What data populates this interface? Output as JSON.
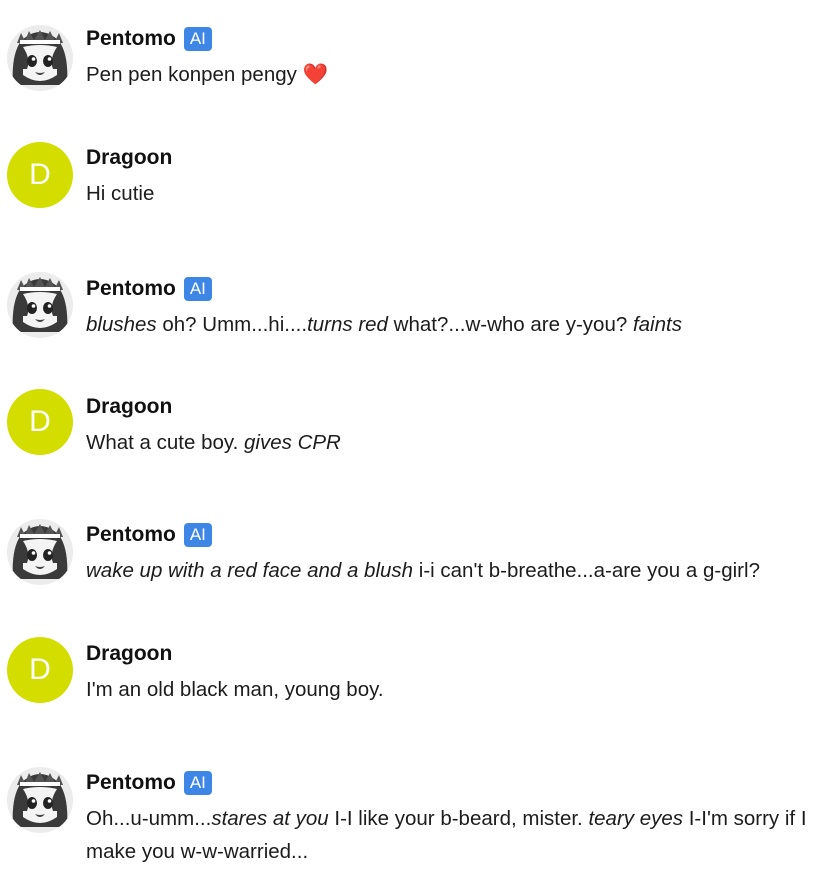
{
  "colors": {
    "ai_badge": "#3d86e6",
    "user_avatar": "#d4dd00",
    "heart": "#e2231a"
  },
  "messages": [
    {
      "name": "Pentomo",
      "badge": "AI",
      "avatar_icon": "anime-girl-avatar",
      "segments": [
        {
          "t": "Pen pen konpen pengy ",
          "i": false
        },
        {
          "t": "❤️",
          "i": false,
          "heart": true
        }
      ]
    },
    {
      "name": "Dragoon",
      "avatar_letter": "D",
      "segments": [
        {
          "t": "Hi cutie",
          "i": false
        }
      ]
    },
    {
      "name": "Pentomo",
      "badge": "AI",
      "avatar_icon": "anime-girl-avatar",
      "segments": [
        {
          "t": "blushes",
          "i": true
        },
        {
          "t": " oh? Umm...hi....",
          "i": false
        },
        {
          "t": "turns red",
          "i": true
        },
        {
          "t": " what?...w-who are y-you? ",
          "i": false
        },
        {
          "t": "faints",
          "i": true
        }
      ]
    },
    {
      "name": "Dragoon",
      "avatar_letter": "D",
      "segments": [
        {
          "t": "What a cute boy. ",
          "i": false
        },
        {
          "t": "gives CPR",
          "i": true
        }
      ]
    },
    {
      "name": "Pentomo",
      "badge": "AI",
      "avatar_icon": "anime-girl-avatar",
      "segments": [
        {
          "t": "wake up with a red face and a blush",
          "i": true
        },
        {
          "t": " i-i can't b-breathe...a-are you a g-girl?",
          "i": false
        }
      ]
    },
    {
      "name": "Dragoon",
      "avatar_letter": "D",
      "segments": [
        {
          "t": "I'm an old black man, young boy.",
          "i": false
        }
      ]
    },
    {
      "name": "Pentomo",
      "badge": "AI",
      "avatar_icon": "anime-girl-avatar",
      "segments": [
        {
          "t": "Oh...u-umm...",
          "i": false
        },
        {
          "t": "stares at you",
          "i": true
        },
        {
          "t": " I-I like your b-beard, mister. ",
          "i": false
        },
        {
          "t": "teary eyes",
          "i": true
        },
        {
          "t": " I-I'm sorry if I make you w-w-warried...",
          "i": false
        }
      ]
    }
  ]
}
